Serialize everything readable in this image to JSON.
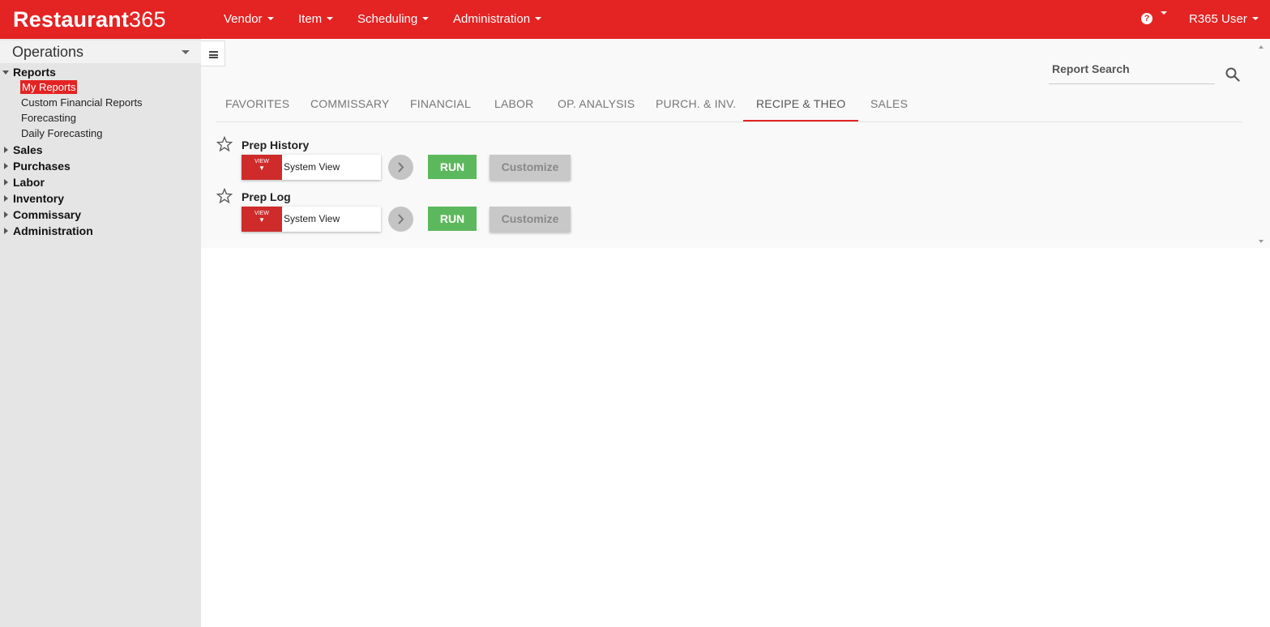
{
  "app": {
    "logo_bold": "Restaurant",
    "logo_num": "365"
  },
  "topnav": {
    "items": [
      {
        "label": "Vendor"
      },
      {
        "label": "Item"
      },
      {
        "label": "Scheduling"
      },
      {
        "label": "Administration"
      }
    ],
    "help_glyph": "?",
    "user_label": "R365 User",
    "brand_color": "#e42323"
  },
  "sidebar": {
    "section_label": "Operations",
    "reports": {
      "label": "Reports",
      "children": [
        {
          "label": "My Reports",
          "active": true
        },
        {
          "label": "Custom Financial Reports"
        },
        {
          "label": "Forecasting"
        },
        {
          "label": "Daily Forecasting"
        }
      ]
    },
    "groups": [
      {
        "label": "Sales"
      },
      {
        "label": "Purchases"
      },
      {
        "label": "Labor"
      },
      {
        "label": "Inventory"
      },
      {
        "label": "Commissary"
      },
      {
        "label": "Administration"
      }
    ]
  },
  "search": {
    "label": "Report Search",
    "icon": "search-icon"
  },
  "tabs": [
    {
      "label": "FAVORITES"
    },
    {
      "label": "COMMISSARY"
    },
    {
      "label": "FINANCIAL"
    },
    {
      "label": "LABOR"
    },
    {
      "label": "OP. ANALYSIS"
    },
    {
      "label": "PURCH. & INV."
    },
    {
      "label": "RECIPE & THEO",
      "active": true
    },
    {
      "label": "SALES"
    }
  ],
  "reports": [
    {
      "title": "Prep History",
      "view_btn_text": "VIEW",
      "view_btn_caret": "▼",
      "view_value": "System View",
      "run_label": "RUN",
      "customize_label": "Customize"
    },
    {
      "title": "Prep Log",
      "view_btn_text": "VIEW",
      "view_btn_caret": "▼",
      "view_value": "System View",
      "run_label": "RUN",
      "customize_label": "Customize"
    }
  ]
}
